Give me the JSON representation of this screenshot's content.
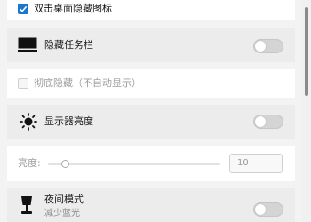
{
  "settings": {
    "hide_desktop_icons": {
      "label": "双击桌面隐藏图标",
      "checked": true
    },
    "hide_taskbar": {
      "label": "隐藏任务栏",
      "icon": "taskbar-icon",
      "enabled": false
    },
    "auto_hide": {
      "label": "彻底隐藏（不自动显示）",
      "checked": false,
      "disabled": true
    },
    "monitor_brightness": {
      "label": "显示器亮度",
      "icon": "sun-icon",
      "enabled": false
    },
    "brightness": {
      "label": "亮度:",
      "value": "10",
      "level": 0.1
    },
    "night_mode": {
      "label": "夜间模式",
      "sublabel": "减少蓝光",
      "icon": "lamp-icon",
      "enabled": false
    }
  },
  "colors": {
    "accent": "#1976d2",
    "toggle_off": "#d4d4d4"
  }
}
